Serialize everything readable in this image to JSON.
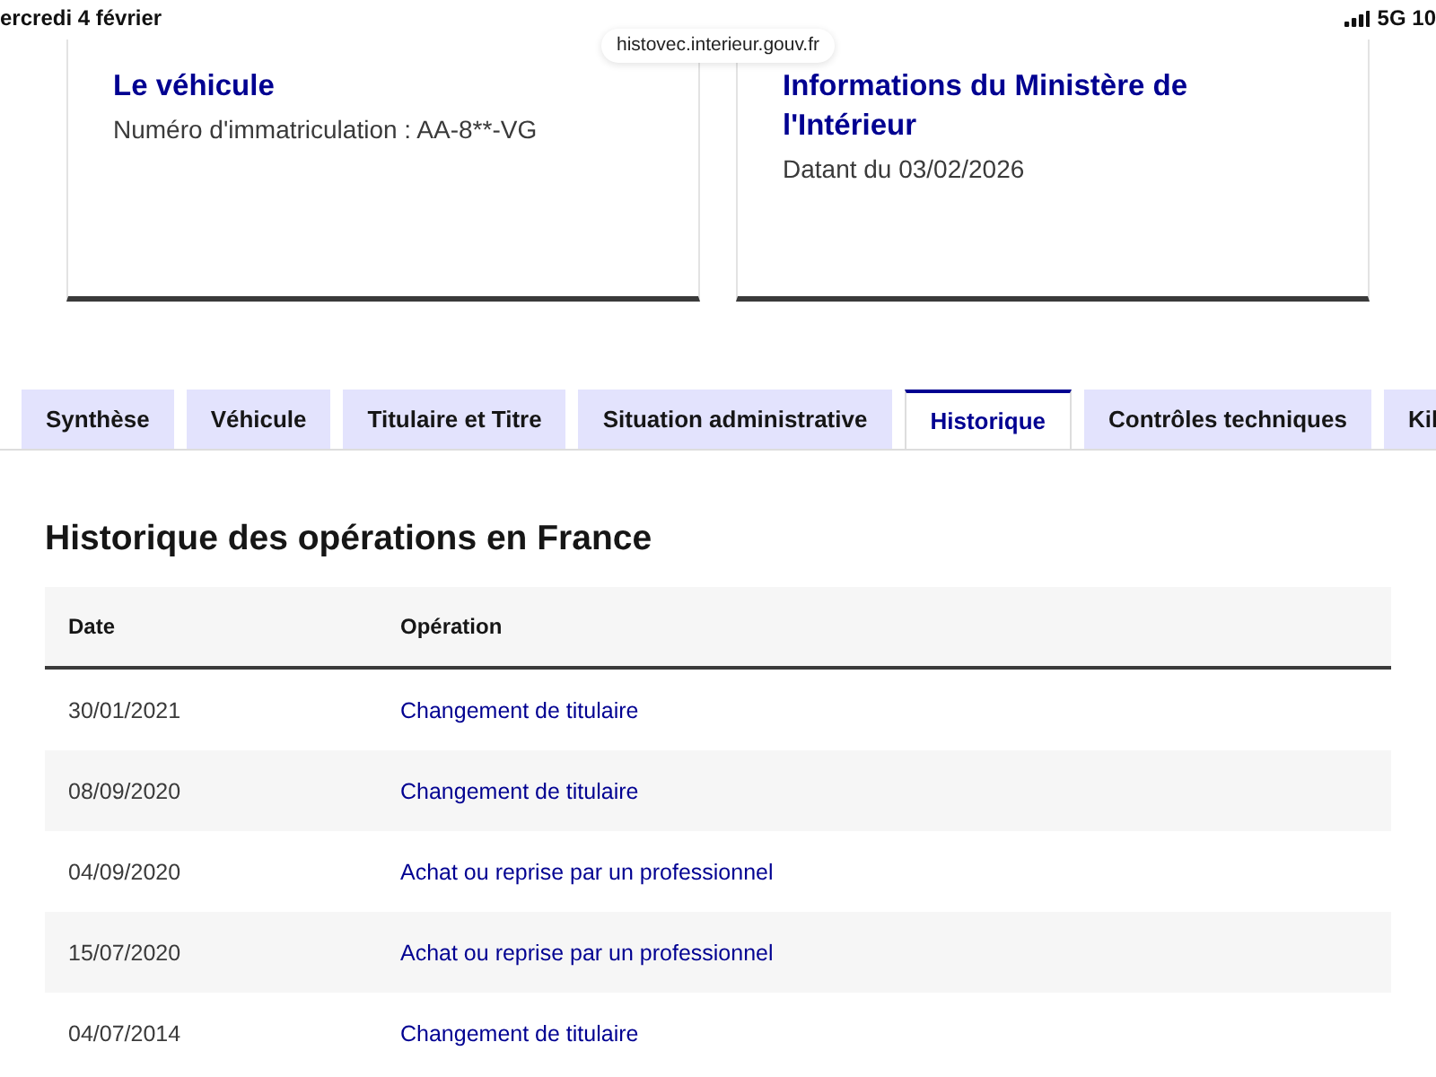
{
  "status_bar": {
    "date": "ercredi 4 février",
    "network": "5G 10"
  },
  "address_bar": {
    "url": "histovec.interieur.gouv.fr"
  },
  "cards": [
    {
      "title": "Le véhicule",
      "text": "Numéro d'immatriculation : AA-8**-VG"
    },
    {
      "title": "Informations du Ministère de l'Intérieur",
      "text": "Datant du 03/02/2026"
    }
  ],
  "tabs": [
    {
      "label": "Synthèse",
      "selected": false
    },
    {
      "label": "Véhicule",
      "selected": false
    },
    {
      "label": "Titulaire et Titre",
      "selected": false
    },
    {
      "label": "Situation administrative",
      "selected": false
    },
    {
      "label": "Historique",
      "selected": true
    },
    {
      "label": "Contrôles techniques",
      "selected": false
    },
    {
      "label": "Kil",
      "selected": false
    }
  ],
  "history": {
    "title": "Historique des opérations en France",
    "table": {
      "columns": [
        "Date",
        "Opération"
      ],
      "rows": [
        [
          "30/01/2021",
          "Changement de titulaire"
        ],
        [
          "08/09/2020",
          "Changement de titulaire"
        ],
        [
          "04/09/2020",
          "Achat ou reprise par un professionnel"
        ],
        [
          "15/07/2020",
          "Achat ou reprise par un professionnel"
        ],
        [
          "04/07/2014",
          "Changement de titulaire"
        ]
      ]
    }
  }
}
